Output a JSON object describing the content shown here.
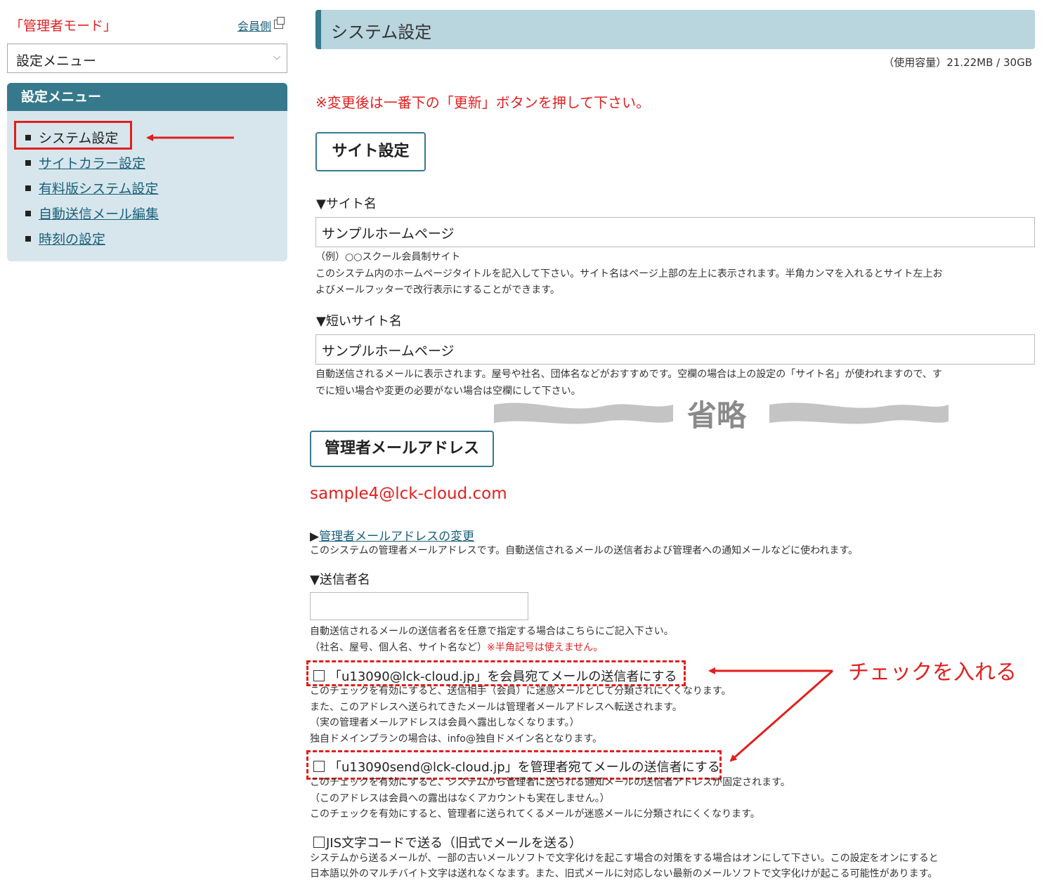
{
  "sidebar": {
    "admin_mode": "「管理者モード」",
    "member_link": "会員側",
    "select_value": "設定メニュー",
    "panel_title": "設定メニュー",
    "items": [
      {
        "label": "システム設定",
        "active": true
      },
      {
        "label": "サイトカラー設定",
        "active": false
      },
      {
        "label": "有料版システム設定",
        "active": false
      },
      {
        "label": "自動送信メール編集",
        "active": false
      },
      {
        "label": "時刻の設定",
        "active": false
      }
    ]
  },
  "header": {
    "title": "システム設定",
    "usage": "（使用容量）21.22MB / 30GB",
    "notice": "※変更後は一番下の「更新」ボタンを押して下さい。"
  },
  "site_settings": {
    "section_title": "サイト設定",
    "site_name_label": "▼サイト名",
    "site_name_value": "サンプルホームページ",
    "site_name_example": "（例）○○スクール会員制サイト",
    "site_name_help_1": "このシステム内のホームページタイトルを記入して下さい。サイト名はページ上部の左上に表示されます。半角カンマを入れるとサイト左上お",
    "site_name_help_2": "よびメールフッターで改行表示にすることができます。",
    "short_name_label": "▼短いサイト名",
    "short_name_value": "サンプルホームページ",
    "short_name_help_1": "自動送信されるメールに表示されます。屋号や社名、団体名などがおすすめです。空欄の場合は上の設定の「サイト名」が使われますので、す",
    "short_name_help_2": "でに短い場合や変更の必要がない場合は空欄にして下さい。"
  },
  "omitted_label": "省略",
  "admin_mail": {
    "section_title": "管理者メールアドレス",
    "email": "sample4@lck-cloud.com",
    "change_prefix": "▶",
    "change_link": "管理者メールアドレスの変更",
    "help": "このシステムの管理者メールアドレスです。自動送信されるメールの送信者および管理者への通知メールなどに使われます。",
    "sender_label": "▼送信者名",
    "sender_value": "",
    "sender_help_1": "自動送信されるメールの送信者名を任意で指定する場合はこちらにご記入下さい。",
    "sender_help_2": "（社名、屋号、個人名、サイト名など）",
    "sender_warning": "※半角記号は使えません。",
    "check1_label": "「u13090@lck-cloud.jp」を会員宛てメールの送信者にする",
    "check1_help_1": "このチェックを有効にすると、送信相手（会員）に迷惑メールとして分類されにくくなります。",
    "check1_help_2": "また、このアドレスへ送られてきたメールは管理者メールアドレスへ転送されます。",
    "check1_help_3": "（実の管理者メールアドレスは会員へ露出しなくなります。）",
    "check1_help_4": "独自ドメインプランの場合は、info@独自ドメイン名となります。",
    "check2_label": "「u13090send@lck-cloud.jp」を管理者宛てメールの送信者にする",
    "check2_help_1": "このチェックを有効にすると、システムから管理者に送られる通知メールの送信者アドレスが固定されます。",
    "check2_help_2": "（このアドレスは会員への露出はなくアカウントも実在しません。）",
    "check2_help_3": "このチェックを有効にすると、管理者に送られてくるメールが迷惑メールに分類されにくくなります。",
    "jis_label": "JIS文字コードで送る（旧式でメールを送る）",
    "jis_help_1": "システムから送るメールが、一部の古いメールソフトで文字化けを起こす場合の対策をする場合はオンにして下さい。この設定をオンにすると",
    "jis_help_2": "日本語以外のマルチバイト文字は送れなくなます。また、旧式メールに対応しない最新のメールソフトで文字化けが起こる可能性があります。"
  },
  "annotation": {
    "instruction": "チェックを入れる",
    "highlight_color": "#e0201e",
    "accent_color": "#36798c"
  }
}
